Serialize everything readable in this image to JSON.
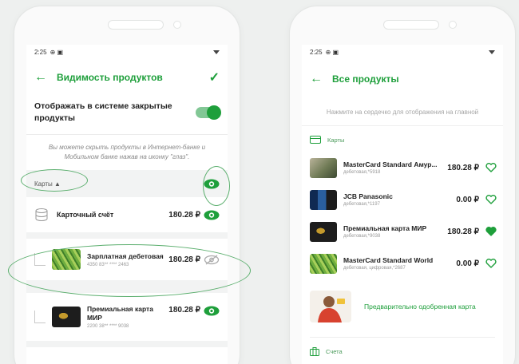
{
  "left_screen": {
    "status_time": "2:25",
    "title": "Видимость продуктов",
    "toggle_label": "Отображать в системе закрытые продукты",
    "hint": "Вы можете скрыть продукты в Интернет-банке и Мобильном банке нажав на иконку \"глаз\".",
    "section_label": "Карты ▲",
    "account": {
      "name": "Карточный счёт",
      "amount": "180.28 ₽"
    },
    "cards": [
      {
        "name": "Зарплатная дебетовая",
        "number": "4350 83** **** 2463",
        "amount": "180.28 ₽",
        "visible": false
      },
      {
        "name": "Премиальная карта МИР",
        "number": "2200 38** **** 9038",
        "amount": "180.28 ₽",
        "visible": true
      }
    ]
  },
  "right_screen": {
    "status_time": "2:25",
    "title": "Все продукты",
    "hint": "Нажмите на сердечко для отображения на главной",
    "section_cards": "Карты",
    "cards": [
      {
        "name": "MasterCard Standard Амур...",
        "sub": "дебетовая,*5918",
        "amount": "180.28 ₽",
        "favorite": false
      },
      {
        "name": "JCB Panasonic",
        "sub": "дебетовая,*1197",
        "amount": "0.00 ₽",
        "favorite": false
      },
      {
        "name": "Премиальная карта МИР",
        "sub": "дебетовая,*9038",
        "amount": "180.28 ₽",
        "favorite": true
      },
      {
        "name": "MasterCard Standard World",
        "sub": "дебетовая, цифровая,*2687",
        "amount": "0.00 ₽",
        "favorite": false
      }
    ],
    "offer": "Предварительно одобренная карта",
    "section_accounts": "Счета"
  },
  "colors": {
    "accent": "#1e9f3b",
    "background": "#eef0ef"
  }
}
